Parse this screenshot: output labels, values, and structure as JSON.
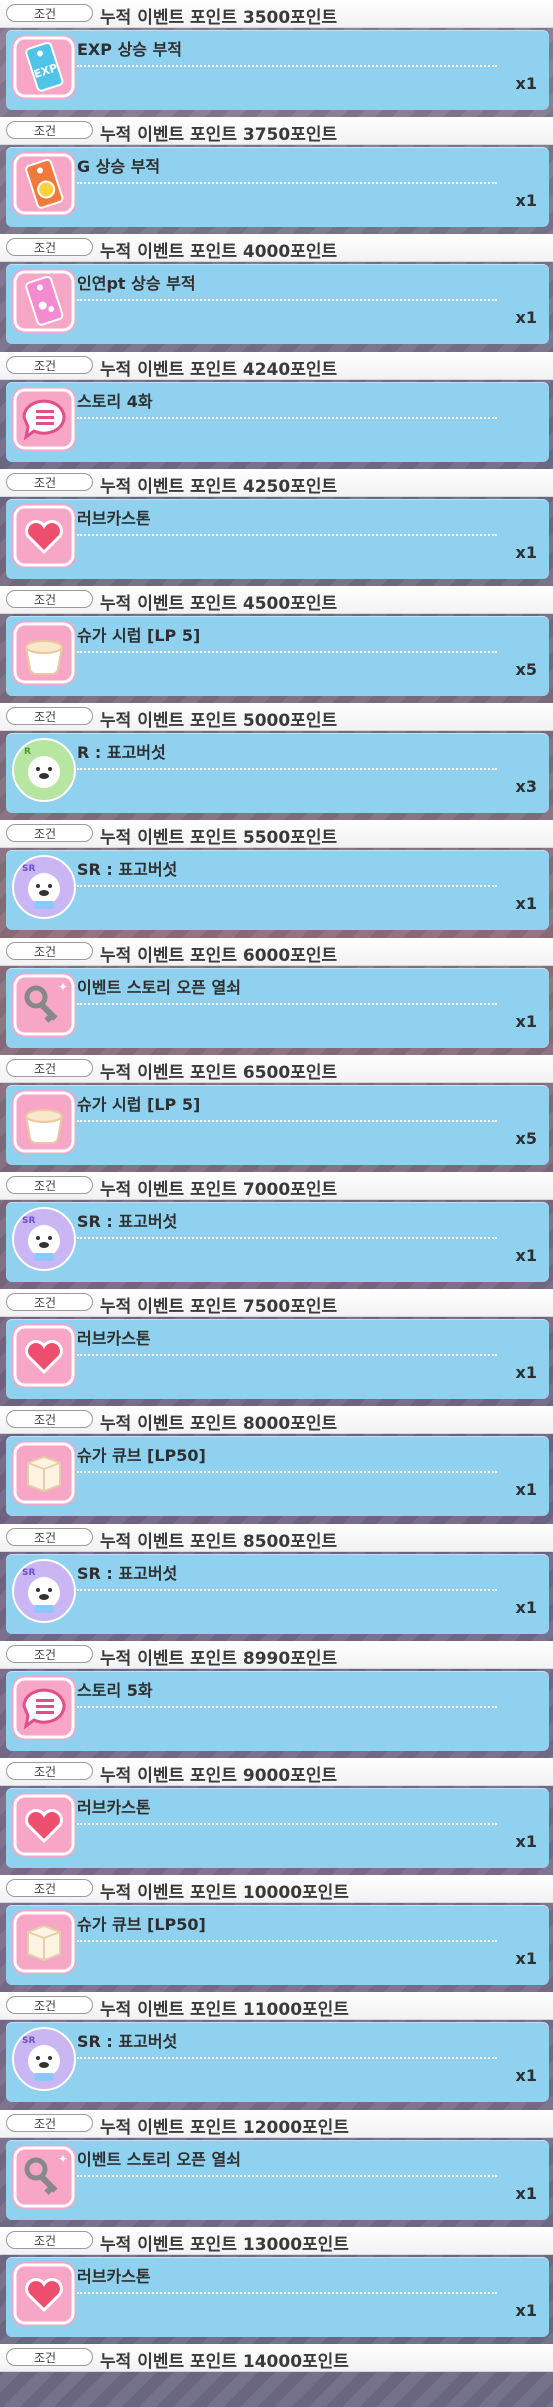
{
  "condition_tag": "조건",
  "rewards": [
    {
      "condition": "누적 이벤트 포인트 3500포인트",
      "item": "EXP 상승 부적",
      "qty": "x1",
      "icon": "exp-charm"
    },
    {
      "condition": "누적 이벤트 포인트 3750포인트",
      "item": "G 상승 부적",
      "qty": "x1",
      "icon": "gold-charm"
    },
    {
      "condition": "누적 이벤트 포인트 4000포인트",
      "item": "인연pt 상승 부적",
      "qty": "x1",
      "icon": "bond-charm"
    },
    {
      "condition": "누적 이벤트 포인트 4240포인트",
      "item": "스토리 4화",
      "qty": "",
      "icon": "story"
    },
    {
      "condition": "누적 이벤트 포인트 4250포인트",
      "item": "러브카스톤",
      "qty": "x1",
      "icon": "lovecastone"
    },
    {
      "condition": "누적 이벤트 포인트 4500포인트",
      "item": "슈가 시럽 [LP 5]",
      "qty": "x5",
      "icon": "sugar-syrup"
    },
    {
      "condition": "누적 이벤트 포인트 5000포인트",
      "item": "R : 표고버섯",
      "qty": "x3",
      "icon": "card-r"
    },
    {
      "condition": "누적 이벤트 포인트 5500포인트",
      "item": "SR : 표고버섯",
      "qty": "x1",
      "icon": "card-sr"
    },
    {
      "condition": "누적 이벤트 포인트 6000포인트",
      "item": "이벤트 스토리 오픈 열쇠",
      "qty": "x1",
      "icon": "key"
    },
    {
      "condition": "누적 이벤트 포인트 6500포인트",
      "item": "슈가 시럽 [LP 5]",
      "qty": "x5",
      "icon": "sugar-syrup"
    },
    {
      "condition": "누적 이벤트 포인트 7000포인트",
      "item": "SR : 표고버섯",
      "qty": "x1",
      "icon": "card-sr"
    },
    {
      "condition": "누적 이벤트 포인트 7500포인트",
      "item": "러브카스톤",
      "qty": "x1",
      "icon": "lovecastone"
    },
    {
      "condition": "누적 이벤트 포인트 8000포인트",
      "item": "슈가 큐브 [LP50]",
      "qty": "x1",
      "icon": "sugar-cube"
    },
    {
      "condition": "누적 이벤트 포인트 8500포인트",
      "item": "SR : 표고버섯",
      "qty": "x1",
      "icon": "card-sr"
    },
    {
      "condition": "누적 이벤트 포인트 8990포인트",
      "item": "스토리 5화",
      "qty": "",
      "icon": "story"
    },
    {
      "condition": "누적 이벤트 포인트 9000포인트",
      "item": "러브카스톤",
      "qty": "x1",
      "icon": "lovecastone"
    },
    {
      "condition": "누적 이벤트 포인트 10000포인트",
      "item": "슈가 큐브 [LP50]",
      "qty": "x1",
      "icon": "sugar-cube"
    },
    {
      "condition": "누적 이벤트 포인트 11000포인트",
      "item": "SR : 표고버섯",
      "qty": "x1",
      "icon": "card-sr"
    },
    {
      "condition": "누적 이벤트 포인트 12000포인트",
      "item": "이벤트 스토리 오픈 열쇠",
      "qty": "x1",
      "icon": "key"
    },
    {
      "condition": "누적 이벤트 포인트 13000포인트",
      "item": "러브카스톤",
      "qty": "x1",
      "icon": "lovecastone"
    },
    {
      "condition": "누적 이벤트 포인트 14000포인트",
      "item": "",
      "qty": "",
      "icon": ""
    }
  ],
  "colors": {
    "card": "#8fd1ee",
    "pink_icon_bg": "#f7a6c6",
    "text": "#2f2f2f"
  }
}
